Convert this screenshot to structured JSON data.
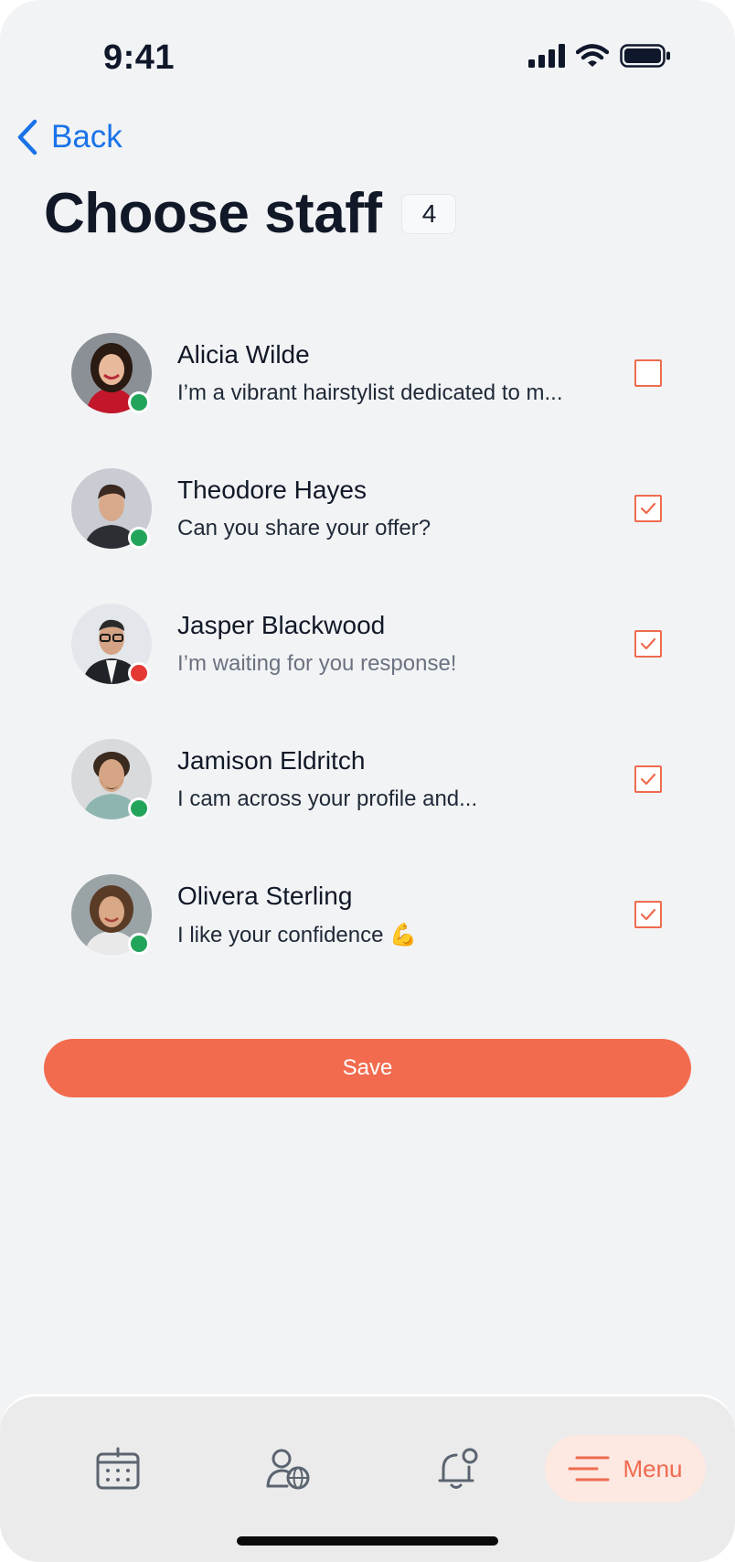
{
  "status_bar": {
    "time": "9:41"
  },
  "nav": {
    "back_label": "Back"
  },
  "header": {
    "title": "Choose staff",
    "selected_count": "4"
  },
  "staff": [
    {
      "name": "Alicia Wilde",
      "message": "I’m a vibrant hairstylist dedicated to m...",
      "status": "online",
      "checked": false
    },
    {
      "name": "Theodore Hayes",
      "message": "Can you share your offer?",
      "status": "online",
      "checked": true
    },
    {
      "name": "Jasper Blackwood",
      "message": "I’m waiting for you response!",
      "status": "busy",
      "checked": true
    },
    {
      "name": "Jamison Eldritch",
      "message": "I cam across your profile and...",
      "status": "online",
      "checked": true
    },
    {
      "name": "Olivera Sterling",
      "message": "I like your confidence 💪",
      "status": "online",
      "checked": true
    }
  ],
  "actions": {
    "save_label": "Save"
  },
  "bottom_nav": {
    "items": [
      {
        "icon": "calendar-icon"
      },
      {
        "icon": "user-globe-icon"
      },
      {
        "icon": "bell-notification-icon"
      },
      {
        "icon": "menu-icon",
        "label": "Menu"
      }
    ]
  },
  "colors": {
    "accent": "#f26b4f",
    "link": "#1a73e8",
    "online": "#22a55b",
    "busy": "#e53935",
    "background": "#f2f3f5"
  }
}
